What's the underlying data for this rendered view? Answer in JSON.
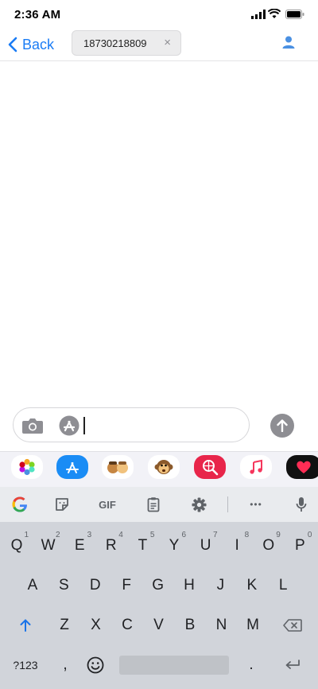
{
  "status_bar": {
    "time": "2:36 AM"
  },
  "nav": {
    "back_label": "Back",
    "recipient": "18730218809",
    "clear_icon": "×"
  },
  "compose": {
    "placeholder": ""
  },
  "app_drawer": [
    "photos-app",
    "app-store-app",
    "memoji-app",
    "animoji-app",
    "search-images-app",
    "music-app",
    "digital-touch-app"
  ],
  "keyboard": {
    "toolbar": {
      "gif_label": "GIF",
      "more_label": "•••"
    },
    "row1": [
      {
        "k": "Q",
        "n": "1"
      },
      {
        "k": "W",
        "n": "2"
      },
      {
        "k": "E",
        "n": "3"
      },
      {
        "k": "R",
        "n": "4"
      },
      {
        "k": "T",
        "n": "5"
      },
      {
        "k": "Y",
        "n": "6"
      },
      {
        "k": "U",
        "n": "7"
      },
      {
        "k": "I",
        "n": "8"
      },
      {
        "k": "O",
        "n": "9"
      },
      {
        "k": "P",
        "n": "0"
      }
    ],
    "row2": [
      "A",
      "S",
      "D",
      "F",
      "G",
      "H",
      "J",
      "K",
      "L"
    ],
    "row3": [
      "Z",
      "X",
      "C",
      "V",
      "B",
      "N",
      "M"
    ],
    "sym_label": "?123",
    "comma_label": ","
  },
  "colors": {
    "accent": "#1a7cf5",
    "send_bg": "#8e8e93",
    "keyboard_bg": "#d1d4da"
  }
}
